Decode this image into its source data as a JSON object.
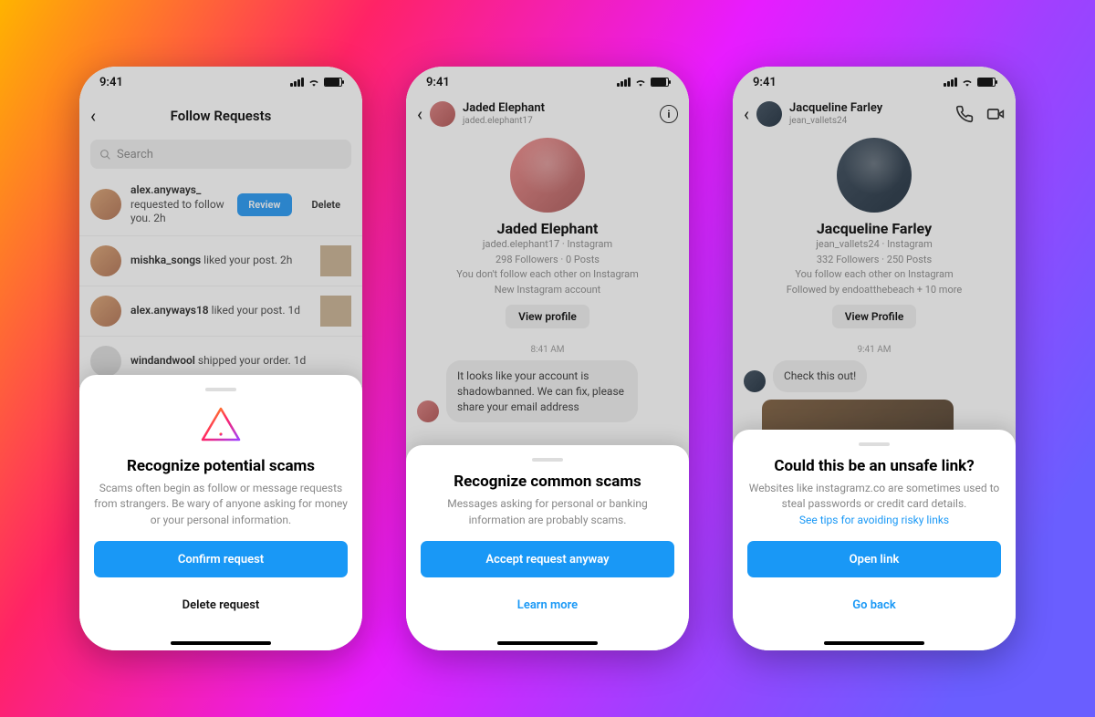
{
  "status": {
    "time": "9:41"
  },
  "phone1": {
    "title": "Follow Requests",
    "search_placeholder": "Search",
    "rows": [
      {
        "user": "alex.anyways_",
        "text": " requested to follow you. ",
        "time": "2h",
        "review": "Review",
        "delete": "Delete"
      },
      {
        "user": "mishka_songs",
        "text": " liked your post. ",
        "time": "2h"
      },
      {
        "user": "alex.anyways18",
        "text": " liked your post. ",
        "time": "1d"
      },
      {
        "user": "windandwool",
        "text": " shipped your order. ",
        "time": "1d"
      }
    ],
    "sheet": {
      "title": "Recognize potential scams",
      "body": "Scams often begin as follow or message requests from strangers. Be wary of anyone asking for money or your personal information.",
      "primary": "Confirm request",
      "secondary": "Delete request"
    }
  },
  "phone2": {
    "header": {
      "name": "Jaded Elephant",
      "handle": "jaded.elephant17"
    },
    "profile": {
      "name": "Jaded Elephant",
      "line1": "jaded.elephant17 · Instagram",
      "line2": "298 Followers · 0 Posts",
      "line3": "You don't follow each other on Instagram",
      "line4": "New Instagram account",
      "view_profile": "View profile"
    },
    "time": "8:41 AM",
    "message": "It looks like your account is shadowbanned. We can fix, please share your email address",
    "sheet": {
      "title": "Recognize common scams",
      "body": "Messages asking for personal or banking information are probably scams.",
      "primary": "Accept request anyway",
      "link": "Learn more"
    }
  },
  "phone3": {
    "header": {
      "name": "Jacqueline Farley",
      "handle": "jean_vallets24"
    },
    "profile": {
      "name": "Jacqueline Farley",
      "line1": "jean_vallets24 · Instagram",
      "line2": "332 Followers · 250 Posts",
      "line3": "You follow each other on Instagram",
      "line4": "Followed by endoatthebeach + 10 more",
      "view_profile": "View Profile"
    },
    "time": "9:41 AM",
    "message": "Check this out!",
    "sheet": {
      "title": "Could this be an unsafe link?",
      "body": "Websites like instagramz.co are sometimes used to steal passwords or credit card details.",
      "tips": "See tips for avoiding risky links",
      "primary": "Open link",
      "link": "Go back"
    }
  }
}
